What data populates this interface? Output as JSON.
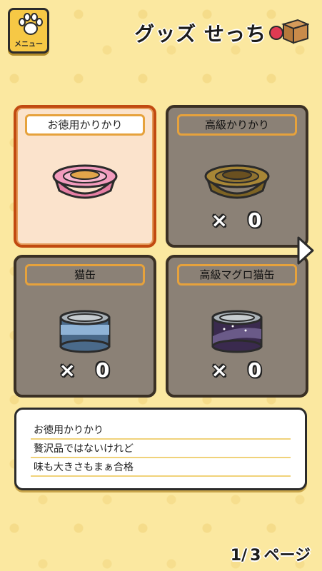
{
  "header": {
    "menu_label": "メニュー",
    "title": "グッズ せっち"
  },
  "items": [
    {
      "name": "お徳用かりかり",
      "state": "selected",
      "icon": "pink-food-bowl-icon"
    },
    {
      "name": "高級かりかり",
      "state": "locked",
      "count_x": "×",
      "count": "0",
      "icon": "gold-food-bowl-icon"
    },
    {
      "name": "猫缶",
      "state": "locked",
      "count_x": "×",
      "count": "0",
      "icon": "blue-cat-can-icon"
    },
    {
      "name": "高級マグロ猫缶",
      "state": "locked",
      "count_x": "×",
      "count": "0",
      "icon": "purple-tuna-can-icon"
    }
  ],
  "description": {
    "lines": [
      "お徳用かりかり",
      "贅沢品ではないけれど",
      "味も大きさもまぁ合格"
    ]
  },
  "pager": {
    "current": "1/",
    "total": "3",
    "suffix": "ページ"
  },
  "colors": {
    "background": "#fbe8a0",
    "selected_border": "#c14a10",
    "locked_tile": "#8b8176",
    "label_border": "#e6a23c"
  }
}
